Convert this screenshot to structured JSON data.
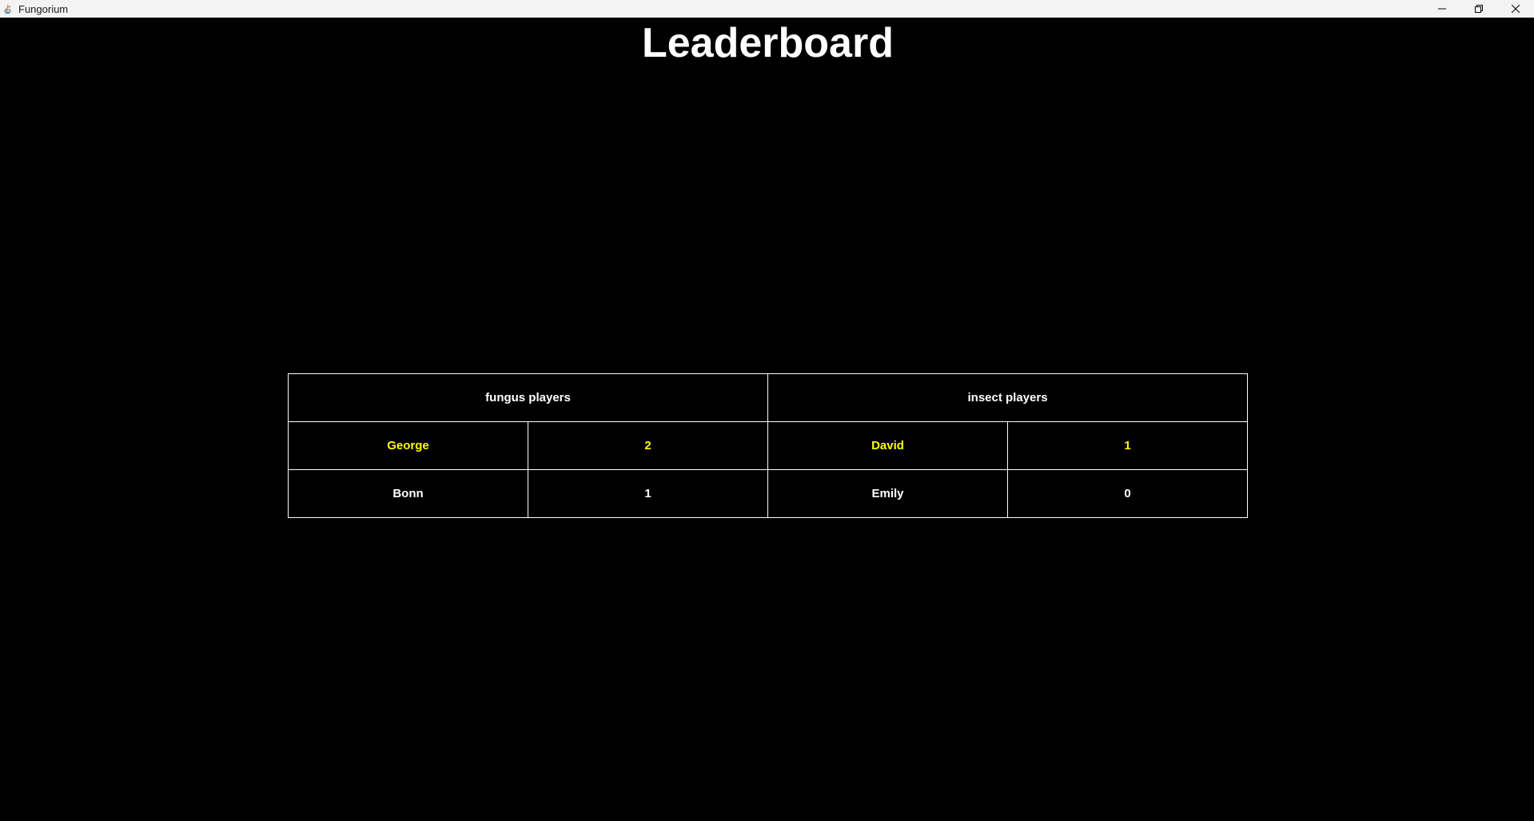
{
  "window": {
    "title": "Fungorium",
    "controls": [
      "minimize-icon",
      "restore-icon",
      "close-icon"
    ]
  },
  "page": {
    "title": "Leaderboard"
  },
  "leaderboard": {
    "headers": {
      "fungus": "fungus players",
      "insect": "insect players"
    },
    "fungus_players": [
      {
        "name": "George",
        "score": "2"
      },
      {
        "name": "Bonn",
        "score": "1"
      }
    ],
    "insect_players": [
      {
        "name": "David",
        "score": "1"
      },
      {
        "name": "Emily",
        "score": "0"
      }
    ]
  },
  "colors": {
    "background": "#000000",
    "text": "#ffffff",
    "leader_highlight": "#ffff00",
    "grid_lines": "#ffffff"
  }
}
